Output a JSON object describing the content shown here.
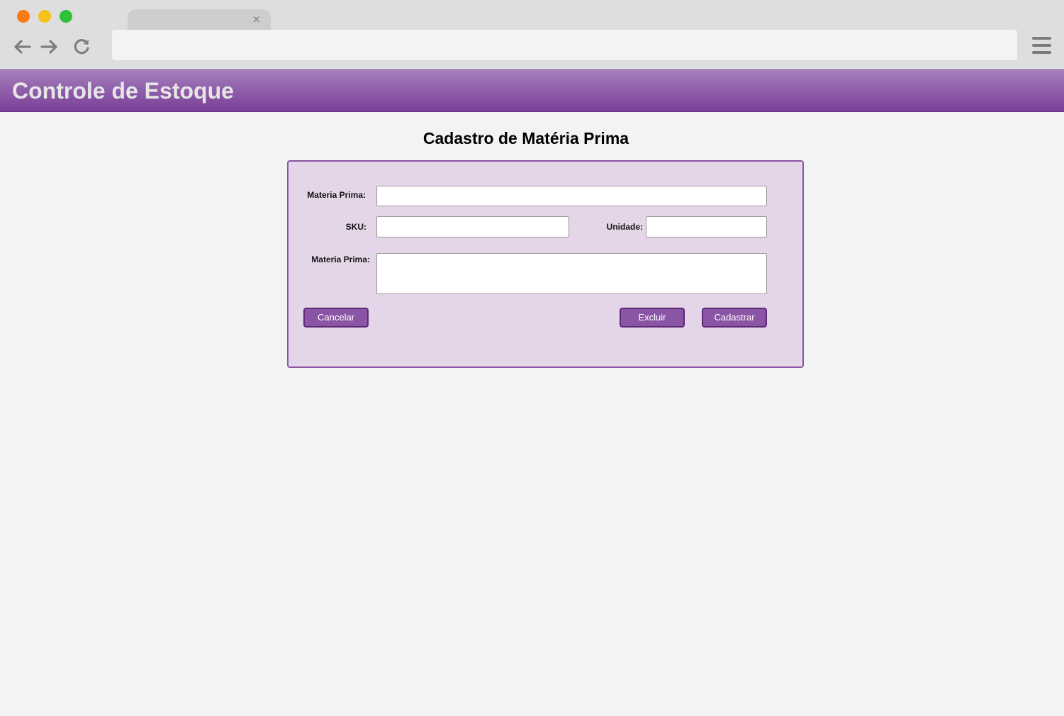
{
  "browser": {
    "tab": {
      "title": "",
      "close_label": "×"
    },
    "address_bar": {
      "value": "",
      "placeholder": ""
    },
    "controls": {
      "back_icon": "arrow-left",
      "forward_icon": "arrow-right",
      "reload_icon": "reload",
      "menu_icon": "hamburger"
    }
  },
  "header": {
    "title": "Controle de Estoque",
    "gradient_top": "#a67fbb",
    "gradient_bottom": "#7a3f97"
  },
  "main": {
    "heading": "Cadastro de Matéria Prima"
  },
  "form": {
    "fields": {
      "materia_prima": {
        "label": "Materia Prima:",
        "value": ""
      },
      "sku": {
        "label": "SKU:",
        "value": ""
      },
      "unidade": {
        "label": "Unidade:",
        "value": ""
      },
      "descricao": {
        "label": "Materia Prima:",
        "value": ""
      }
    },
    "buttons": {
      "cancel": "Cancelar",
      "delete": "Excluir",
      "submit": "Cadastrar"
    },
    "colors": {
      "panel_bg": "#e4d5e8",
      "panel_border": "#8a53a3",
      "button_bg": "#8b55a5"
    }
  }
}
